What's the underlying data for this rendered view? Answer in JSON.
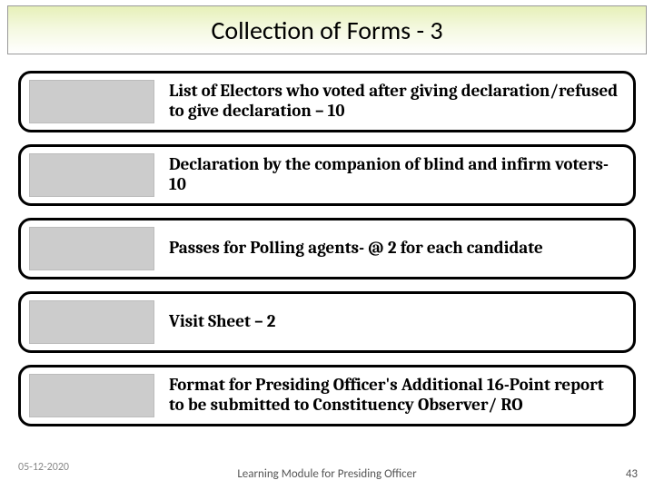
{
  "title": "Collection of Forms - 3",
  "items": [
    {
      "text": "List of Electors who voted after giving declaration/refused to give declaration – 10"
    },
    {
      "text": "Declaration by the companion of blind and infirm voters-10"
    },
    {
      "text": "Passes for Polling agents- @ 2 for each candidate"
    },
    {
      "text": "Visit Sheet – 2"
    },
    {
      "text": "Format for Presiding Officer's Additional 16-Point report to be submitted to Constituency Observer/ RO"
    }
  ],
  "footer": {
    "date": "05-12-2020",
    "module": "Learning Module for Presiding Officer",
    "page": "43"
  }
}
